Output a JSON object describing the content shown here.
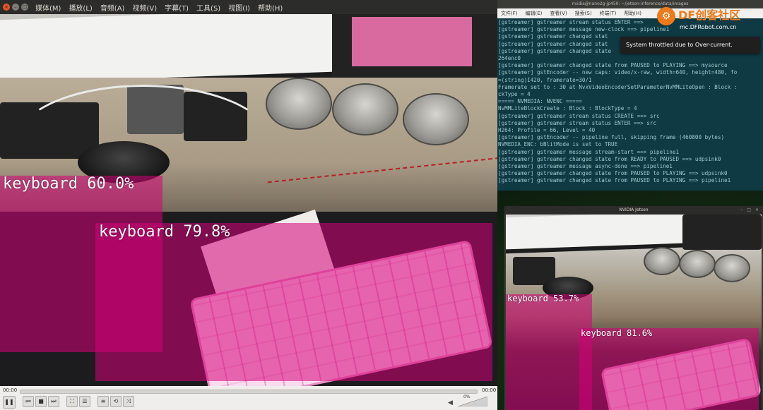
{
  "vlc": {
    "menu": [
      "媒体(M)",
      "播放(L)",
      "音频(A)",
      "视频(V)",
      "字幕(T)",
      "工具(S)",
      "视图(I)",
      "帮助(H)"
    ],
    "detections": [
      {
        "label": "keyboard 60.0%"
      },
      {
        "label": "keyboard 79.8%"
      }
    ],
    "time_elapsed": "00:00",
    "time_total": "00:00",
    "volume": "0%"
  },
  "terminal": {
    "title": "nvidia@nano2g-jp450: ~/jetson-inference/data/images",
    "menu": [
      "文件(F)",
      "编辑(E)",
      "查看(V)",
      "搜索(S)",
      "终端(T)",
      "帮助(H)"
    ],
    "lines": [
      "[gstreamer] gstreamer stream status ENTER ==>",
      "[gstreamer] gstreamer message new-clock ==> pipeline1",
      "[gstreamer] gstreamer changed stat",
      "[gstreamer] gstreamer changed stat",
      "[gstreamer] gstreamer changed state",
      "264enc0",
      "[gstreamer] gstreamer changed state from PAUSED to PLAYING ==> mysource",
      "[gstreamer] gstEncoder -- new caps: video/x-raw, width=640, height=480, fo",
      "=(string)I420, framerate=30/1",
      "Framerate set to : 30 at NvxVideoEncoderSetParameterNvMMLiteOpen : Block :",
      "ckType = 4",
      "===== NVMEDIA: NVENC =====",
      "NvMMLiteBlockCreate : Block : BlockType = 4",
      "[gstreamer] gstreamer stream status CREATE ==> src",
      "[gstreamer] gstreamer stream status ENTER ==> src",
      "H264: Profile = 66, Level = 40",
      "[gstreamer] gstEncoder -- pipeline full, skipping frame (460800 bytes)",
      "NVMEDIA_ENC: bBlitMode is set to TRUE",
      "[gstreamer] gstreamer message stream-start ==> pipeline1",
      "[gstreamer] gstreamer changed state from READY to PAUSED ==> udpsink0",
      "[gstreamer] gstreamer message async-done ==> pipeline1",
      "[gstreamer] gstreamer changed state from PAUSED to PLAYING ==> udpsink0",
      "[gstreamer] gstreamer changed state from PAUSED to PLAYING ==> pipeline1"
    ],
    "toast": "System throttled due to Over-current."
  },
  "logo": {
    "brand": "DF创客社区",
    "url": "mc.DFRobot.com.cn"
  },
  "jetson": {
    "title": "NVIDIA Jetson",
    "detections": [
      {
        "label": "keyboard 53.7%"
      },
      {
        "label": "keyboard 81.6%"
      }
    ]
  },
  "colors": {
    "detection_box": "#d60078",
    "terminal_bg": "#0f3a44",
    "brand_orange": "#f07a1a"
  }
}
